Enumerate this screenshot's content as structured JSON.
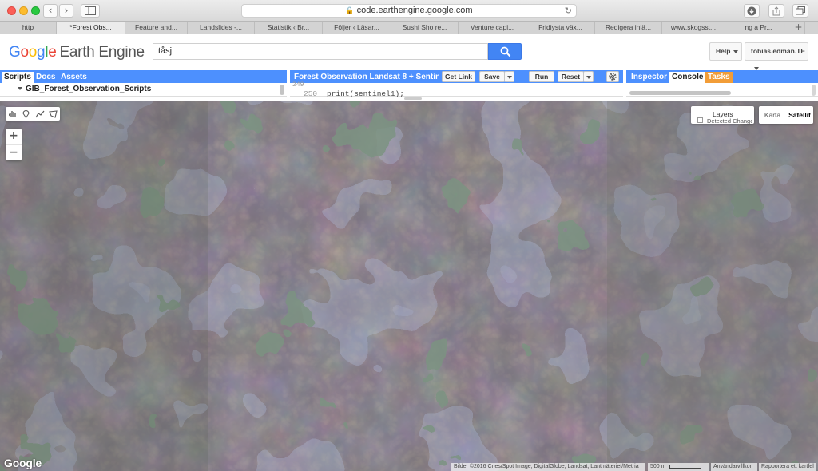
{
  "browser": {
    "url": "code.earthengine.google.com",
    "tabs": [
      {
        "label": "http",
        "active": false
      },
      {
        "label": "*Forest Obs...",
        "active": true
      },
      {
        "label": "Feature and...",
        "active": false
      },
      {
        "label": "Landslides -...",
        "active": false
      },
      {
        "label": "Statistik ‹ Br...",
        "active": false
      },
      {
        "label": "Följer ‹ Läsar...",
        "active": false
      },
      {
        "label": "Sushi Sho re...",
        "active": false
      },
      {
        "label": "Venture capi...",
        "active": false
      },
      {
        "label": "Fridiysta väx...",
        "active": false
      },
      {
        "label": "Redigera inlä...",
        "active": false
      },
      {
        "label": "www.skogsst...",
        "active": false
      },
      {
        "label": "ng a Pr...",
        "active": false
      }
    ]
  },
  "header": {
    "logo_google": "Google",
    "logo_product": "Earth Engine",
    "search_value": "tåsj",
    "help_label": "Help",
    "user_label": "tobias.edman.TE"
  },
  "scripts_panel": {
    "tabs": [
      "Scripts",
      "Docs",
      "Assets"
    ],
    "active_tab": "Scripts",
    "tree_item": "GIB_Forest_Observation_Scripts"
  },
  "editor": {
    "title": "Forest Observation Landsat 8 + Sentin...",
    "get_link": "Get Link",
    "save": "Save",
    "run": "Run",
    "reset": "Reset",
    "lines": [
      {
        "num": "249",
        "code": ""
      },
      {
        "num": "250",
        "code": "print(sentinel1);"
      }
    ]
  },
  "right_panel": {
    "tabs": [
      "Inspector",
      "Console",
      "Tasks"
    ],
    "active_tab": "Console"
  },
  "map": {
    "layers_label": "Layers",
    "layer_item": "Detected Change",
    "map_types": [
      "Karta",
      "Satellit"
    ],
    "selected_map_type": "Satellit",
    "zoom_in": "+",
    "zoom_out": "−",
    "watermark": "Google",
    "attribution": "Bilder ©2016 Cnes/Spot Image, DigitalGlobe, Landsat, Lantmäteriet/Metria",
    "scale": "500 m",
    "terms": "Användarvillkor",
    "report": "Rapportera ett kartfel"
  },
  "colors": {
    "accent_blue": "#4d90fe",
    "search_blue": "#4285f4",
    "tasks_orange": "#f29d38"
  }
}
